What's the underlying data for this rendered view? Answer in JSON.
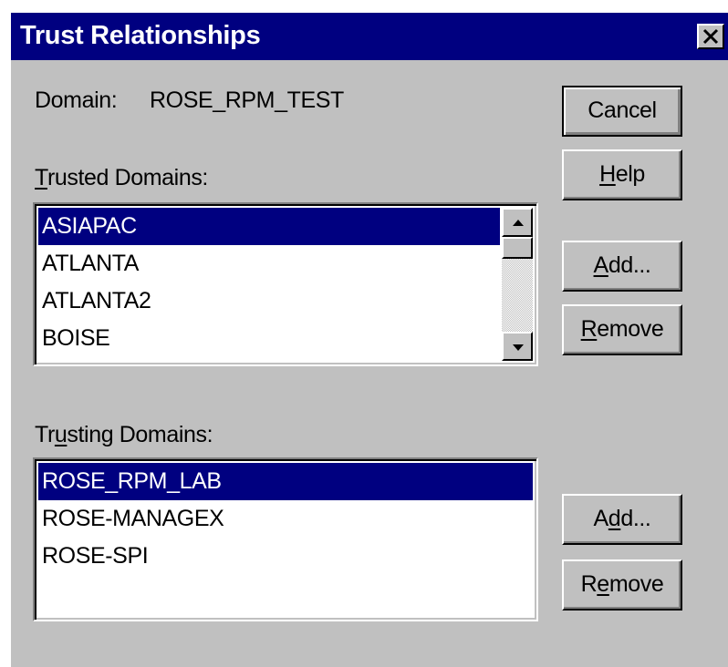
{
  "window": {
    "title": "Trust Relationships"
  },
  "domain": {
    "label": "Domain:",
    "value": "ROSE_RPM_TEST"
  },
  "buttons": {
    "cancel": "Cancel",
    "help": {
      "pre": "",
      "key": "H",
      "post": "elp"
    }
  },
  "trusted": {
    "label": {
      "pre": "",
      "key": "T",
      "post": "rusted Domains:"
    },
    "items": [
      "ASIAPAC",
      "ATLANTA",
      "ATLANTA2",
      "BOISE"
    ],
    "selected_index": 0,
    "add": {
      "pre": "",
      "key": "A",
      "post": "dd..."
    },
    "remove": {
      "pre": "",
      "key": "R",
      "post": "emove"
    }
  },
  "trusting": {
    "label": {
      "pre": "Tr",
      "key": "u",
      "post": "sting Domains:"
    },
    "items": [
      "ROSE_RPM_LAB",
      "ROSE-MANAGEX",
      "ROSE-SPI"
    ],
    "selected_index": 0,
    "add": {
      "pre": "A",
      "key": "d",
      "post": "d..."
    },
    "remove": {
      "pre": "R",
      "key": "e",
      "post": "move"
    }
  },
  "icons": {
    "close": "close-icon",
    "scroll_up": "scroll-up-arrow-icon",
    "scroll_down": "scroll-down-arrow-icon"
  },
  "colors": {
    "titlebar": "#000080",
    "face": "#c0c0c0",
    "selection": "#000080"
  }
}
